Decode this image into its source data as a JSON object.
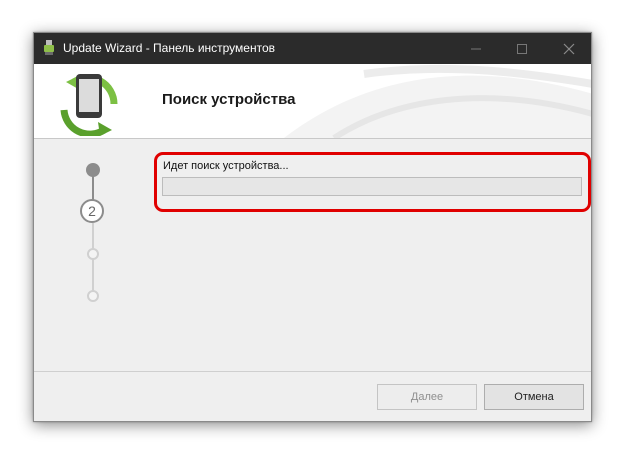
{
  "window": {
    "title": "Update Wizard - Панель инструментов",
    "icons": {
      "app": "usb-plug-icon",
      "minimize": "minimize-icon",
      "maximize": "maximize-icon",
      "close": "close-icon"
    }
  },
  "header": {
    "title": "Поиск устройства",
    "logo_icon": "phone-sync-icon"
  },
  "steps": {
    "current": "2",
    "items": [
      {
        "state": "done"
      },
      {
        "state": "current",
        "number": "2"
      },
      {
        "state": "pending"
      },
      {
        "state": "pending"
      }
    ]
  },
  "main": {
    "status_text": "Идет поиск устройства...",
    "progress": 0
  },
  "footer": {
    "next_label": "Далее",
    "cancel_label": "Отмена"
  },
  "colors": {
    "titlebar": "#2b2b2b",
    "highlight": "#e00000",
    "progress_fill": "#06b025",
    "logo_green": "#5aa02c"
  }
}
